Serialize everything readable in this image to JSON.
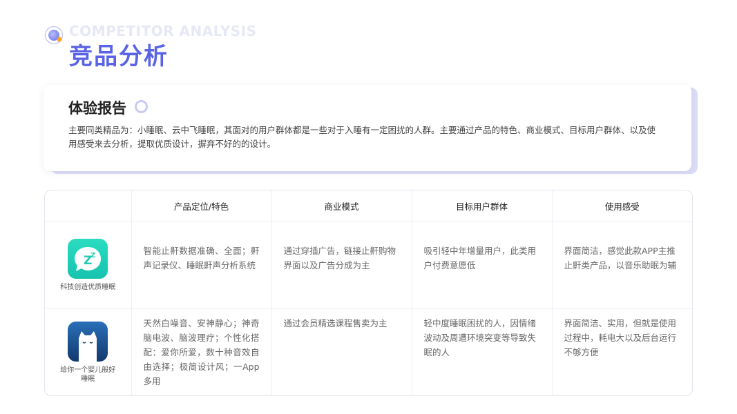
{
  "header": {
    "en_title": "COMPETITOR ANALYSIS",
    "cn_title": "竞品分析"
  },
  "report": {
    "title": "体验报告",
    "body": "主要同类精品为：小睡眠、云中飞睡眠，其面对的用户群体都是一些对于入睡有一定困扰的人群。主要通过产品的特色、商业模式、目标用户群体、以及使用感受来去分析，提取优质设计，摒弃不好的的设计。"
  },
  "table": {
    "headers": [
      "",
      "产品定位/特色",
      "商业模式",
      "目标用户群体",
      "使用感受"
    ],
    "rows": [
      {
        "app_name": "科技创造优质睡眠",
        "icon": "xiaoshuimian-zz-app-icon",
        "icon_color": "#1fd1b7",
        "positioning": "智能止鼾数据准确、全面；鼾声记录仪、睡眠鼾声分析系统",
        "business": "通过穿插广告，链接止鼾购物界面以及广告分成为主",
        "target": "吸引轻中年增量用户，此类用户付费意愿低",
        "experience": "界面简洁，感觉此款APP主推止鼾类产品，以音乐助眠为辅"
      },
      {
        "app_name": "给你一个婴儿般好睡眠",
        "icon": "cat-app-icon",
        "icon_color": "#1d4f8c",
        "positioning": "天然白噪音、安神静心；神奇脑电波、脑波理疗；个性化搭配：爱你所爱，数十种音效自由选择；极简设计风；一App多用",
        "business": "通过会员精选课程售卖为主",
        "target": "轻中度睡眠困扰的人，因情绪波动及周遭环境突变等导致失眠的人",
        "experience": "界面简洁、实用，但就是使用过程中，耗电大以及后台运行不够方便"
      }
    ]
  },
  "colors": {
    "accent": "#5a63e6",
    "ring": "#c9cbf3",
    "orange_dot": "#f5a623"
  }
}
